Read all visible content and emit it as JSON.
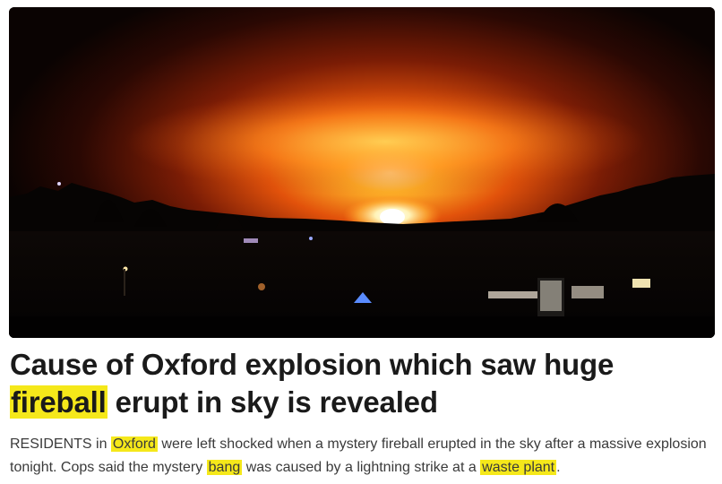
{
  "article": {
    "image": {
      "alt": ""
    },
    "headline": {
      "part1": "Cause of Oxford explosion which saw huge",
      "highlight": "fireball",
      "part2": " erupt in sky is revealed"
    },
    "standfirst": {
      "t1": "RESIDENTS in ",
      "h1": "Oxford",
      "t2": " were left shocked when a mystery fireball erupted in the sky after a massive explosion tonight. Cops said the mystery ",
      "h2": "bang",
      "t3": " was caused by a lightning strike at a ",
      "h3": "waste plant",
      "t4": "."
    },
    "colors": {
      "highlight": "#f5e81a",
      "headline_text": "#1a1a1a",
      "body_text": "#3a3a3a"
    }
  }
}
